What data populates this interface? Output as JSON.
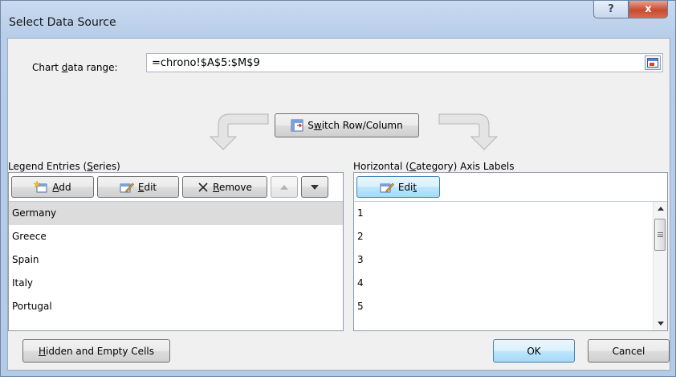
{
  "window": {
    "title": "Select Data Source",
    "help_label": "?",
    "close_label": "x"
  },
  "range": {
    "label_pre": "Chart ",
    "label_key": "d",
    "label_post": "ata range:",
    "value": "=chrono!$A$5:$M$9"
  },
  "switch": {
    "pre": "S",
    "key": "w",
    "post": "itch Row/Column"
  },
  "legend": {
    "label_pre": "Legend Entries (",
    "label_key": "S",
    "label_post": "eries)",
    "add": {
      "key": "A",
      "post": "dd"
    },
    "edit": {
      "key": "E",
      "post": "dit"
    },
    "remove": {
      "key": "R",
      "post": "emove"
    },
    "items": [
      "Germany",
      "Greece",
      "Spain",
      "Italy",
      "Portugal"
    ],
    "selected_index": 0
  },
  "axis": {
    "label_pre": "Horizontal (",
    "label_key": "C",
    "label_post": "ategory) Axis Labels",
    "edit": {
      "pre": "Edi",
      "key": "t",
      "post": ""
    },
    "items": [
      "1",
      "2",
      "3",
      "4",
      "5"
    ]
  },
  "footer": {
    "hidden": {
      "key": "H",
      "post": "idden and Empty Cells"
    },
    "ok": "OK",
    "cancel": "Cancel"
  },
  "icons": [
    "help-icon",
    "close-icon",
    "range-select-icon",
    "switch-icon",
    "add-series-icon",
    "edit-icon",
    "remove-icon",
    "move-up-icon",
    "move-down-icon",
    "scroll-up-icon",
    "scroll-down-icon"
  ]
}
